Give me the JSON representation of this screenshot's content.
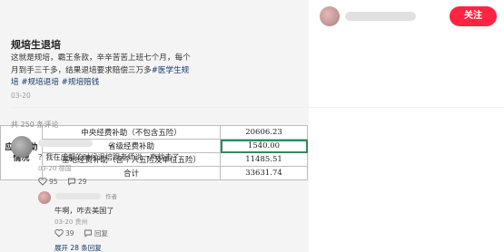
{
  "sheet": {
    "row_header": "应退补助情况",
    "rows": [
      {
        "label": "中央经费补助（不包含五险）",
        "value": "20606.23"
      },
      {
        "label": "省级经费补助",
        "value": "1540.00"
      },
      {
        "label": "基地经费补助（含个人五险及单位五险）",
        "value": "11485.51"
      },
      {
        "label": "合计",
        "value": "33631.74"
      }
    ]
  },
  "post": {
    "follow_label": "关注",
    "title": "规培生退培",
    "body": "这就是规培，霸王条款，辛辛苦苦上班七个月，每个月到手三千多，结果退培要求赔偿三万多",
    "tags": [
      "#医学生规培",
      "#规培退培",
      "#规培赔钱"
    ],
    "date": "03-20"
  },
  "comments": {
    "count_label": "共 250 条评论",
    "items": [
      {
        "text": "？我在成都的时候退培跟老师说一声就走了",
        "meta": "03-20 德国",
        "likes": "95",
        "replies": "29"
      }
    ],
    "reply": {
      "badge": "作者",
      "text": "牛啊，咋去美国了",
      "meta": "03-20 贵州",
      "likes": "39",
      "reply_label": "回复"
    },
    "expand_label": "展开 28 条回复"
  }
}
